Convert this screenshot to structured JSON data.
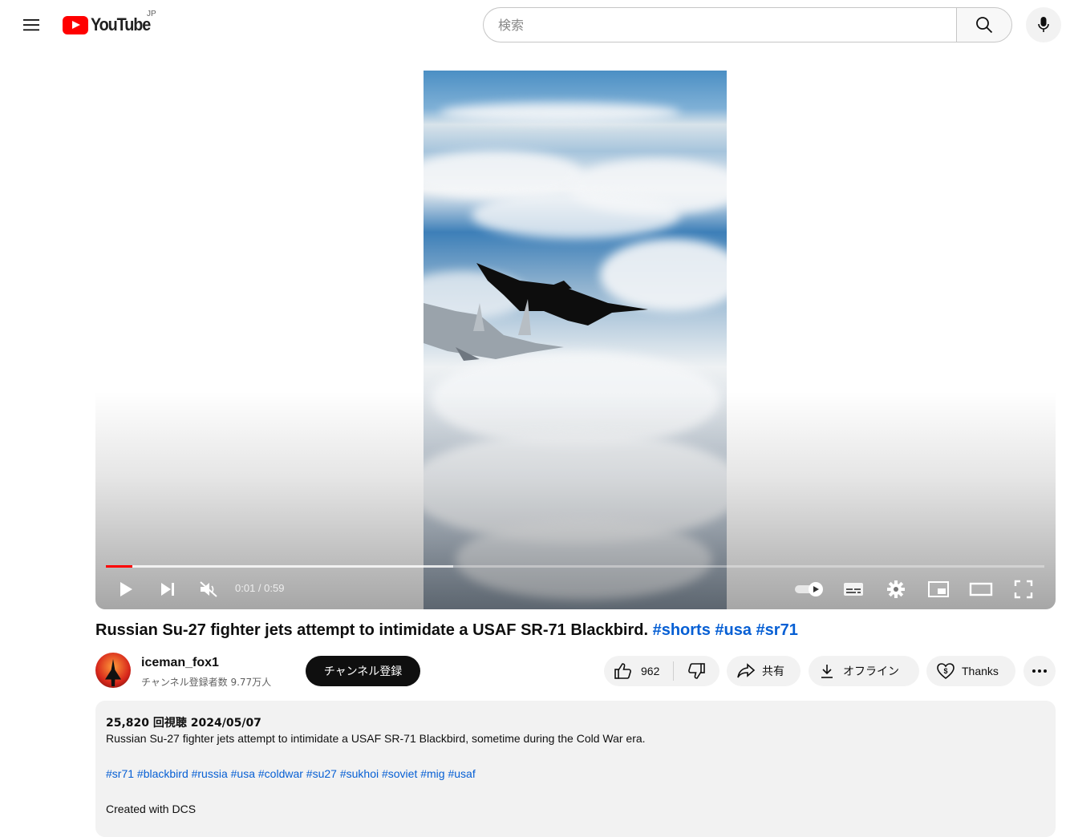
{
  "header": {
    "logo_text": "YouTube",
    "region": "JP",
    "search_placeholder": "検索"
  },
  "player": {
    "time_display": "0:01 / 0:59",
    "progress_played_fraction": 0.028,
    "progress_buffered_fraction": 0.37
  },
  "video": {
    "title": "Russian Su-27 fighter jets attempt to intimidate a USAF SR-71 Blackbird.",
    "title_hashtags": "#shorts #usa #sr71"
  },
  "channel": {
    "name": "iceman_fox1",
    "subscribers": "チャンネル登録者数 9.77万人",
    "subscribe_label": "チャンネル登録"
  },
  "actions": {
    "like_count": "962",
    "share_label": "共有",
    "download_label": "オフライン",
    "thanks_label": "Thanks"
  },
  "description": {
    "views_date": "25,820 回視聴  2024/05/07",
    "text": "Russian Su-27 fighter jets attempt to intimidate a USAF SR-71 Blackbird, sometime during the Cold War era.",
    "hashtags": "#sr71 #blackbird #russia #usa #coldwar #su27 #sukhoi #soviet #mig #usaf",
    "footer": "Created with DCS"
  },
  "colors": {
    "brand_red": "#ff0000",
    "link_blue": "#065fd4",
    "pill_bg": "#f2f2f2"
  }
}
